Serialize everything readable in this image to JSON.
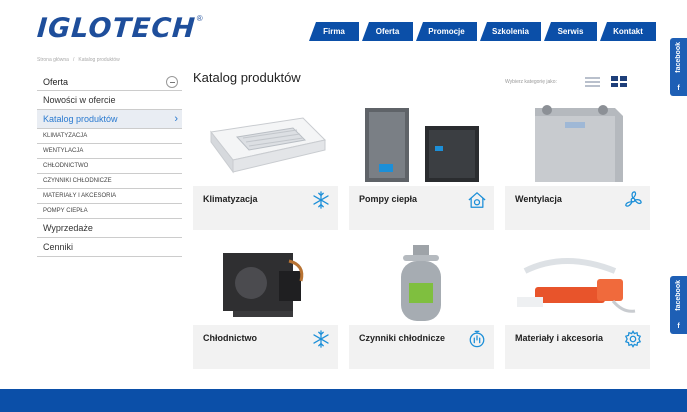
{
  "brand": {
    "name": "IGLOTECH",
    "registered": "®"
  },
  "nav": {
    "items": [
      "Firma",
      "Oferta",
      "Promocje",
      "Szkolenia",
      "Serwis",
      "Kontakt"
    ]
  },
  "breadcrumb": {
    "home": "Strona główna",
    "sep": "/",
    "current": "Katalog produktów"
  },
  "social": {
    "label": "facebook",
    "letter": "f"
  },
  "sidebar": {
    "header": "Oferta",
    "items_top": [
      "Nowości w ofercie"
    ],
    "active": "Katalog produktów",
    "active_arrow": "›",
    "subitems": [
      "KLIMATYZACJA",
      "WENTYLACJA",
      "CHŁODNICTWO",
      "CZYNNIKI CHŁODNICZE",
      "MATERIAŁY I AKCESORIA",
      "POMPY CIEPŁA"
    ],
    "items_bottom": [
      "Wyprzedaże",
      "Cenniki"
    ]
  },
  "main": {
    "title": "Katalog produktów",
    "view_label": "Wybierz kategorię jako:"
  },
  "cards": [
    {
      "label": "Klimatyzacja",
      "icon": "snowflake-icon"
    },
    {
      "label": "Pompy ciepła",
      "icon": "heat-pump-icon"
    },
    {
      "label": "Wentylacja",
      "icon": "fan-icon"
    },
    {
      "label": "Chłodnictwo",
      "icon": "snowflake-icon"
    },
    {
      "label": "Czynniki chłodnicze",
      "icon": "gauge-icon"
    },
    {
      "label": "Materiały i akcesoria",
      "icon": "gear-icon"
    }
  ],
  "colors": {
    "accent": "#0b4fa8",
    "icon": "#1c8fd8",
    "active_link": "#2a7ad0"
  }
}
